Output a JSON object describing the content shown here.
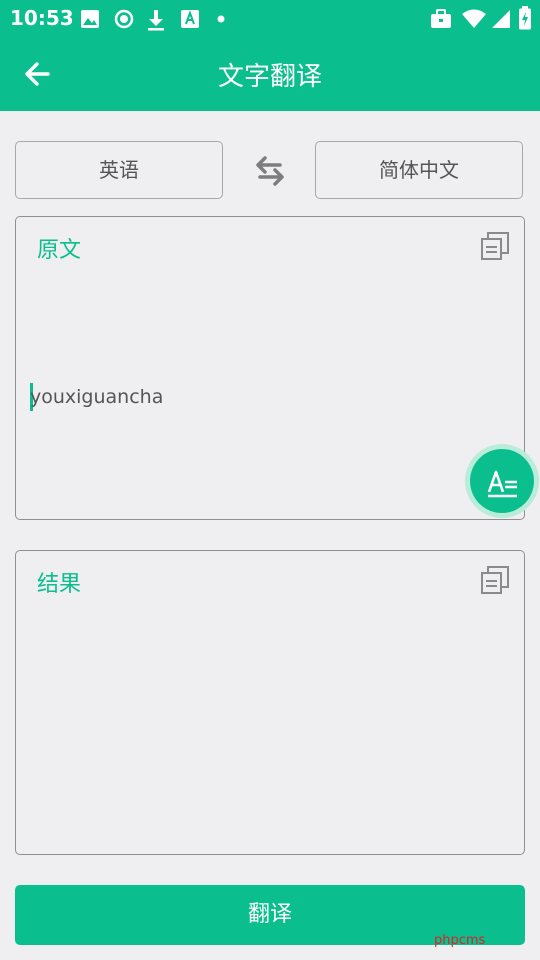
{
  "status_bar": {
    "time": "10:53",
    "left_icons": [
      "image-icon",
      "record-icon",
      "download-icon",
      "a-badge-icon",
      "dot-icon"
    ],
    "right_icons": [
      "briefcase-icon",
      "wifi-icon",
      "signal-icon",
      "battery-charging-icon"
    ]
  },
  "app_bar": {
    "title": "文字翻译",
    "back_icon": "arrow-left-icon"
  },
  "languages": {
    "source": "英语",
    "target": "简体中文",
    "swap_icon": "swap-arrows-icon"
  },
  "source_panel": {
    "label": "原文",
    "text": "youxiguancha",
    "copy_icon": "copy-icon"
  },
  "fab": {
    "icon": "text-format-icon",
    "letter": "A"
  },
  "result_panel": {
    "label": "结果",
    "text": "",
    "copy_icon": "copy-icon"
  },
  "action": {
    "translate_label": "翻译"
  },
  "watermark": "phpcms",
  "colors": {
    "accent": "#0abf8d",
    "background": "#efeff1",
    "border": "#8f8f8f",
    "watermark": "#d9222a"
  }
}
